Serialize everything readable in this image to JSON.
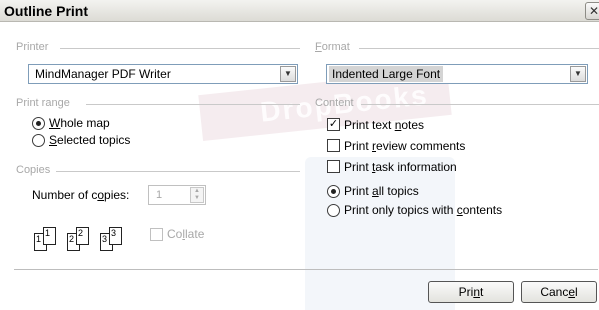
{
  "window": {
    "title": "Outline Print",
    "close_glyph": "✕"
  },
  "watermark": {
    "text": "DropBooks"
  },
  "printer": {
    "group_label": "Printer",
    "selected": "MindManager PDF Writer"
  },
  "format": {
    "group_label": "Format",
    "selected": "Indented Large Font"
  },
  "print_range": {
    "group_label": "Print range",
    "options": [
      {
        "label": "Whole map",
        "mnemonic": "W",
        "rest": "hole map",
        "checked": true
      },
      {
        "label": "Selected topics",
        "mnemonic": "S",
        "rest": "elected topics",
        "checked": false
      }
    ]
  },
  "content": {
    "group_label": "Content",
    "checkboxes": [
      {
        "before": "Print text ",
        "mnemonic": "n",
        "after": "otes",
        "checked": true
      },
      {
        "before": "Print ",
        "mnemonic": "r",
        "after": "eview comments",
        "checked": false
      },
      {
        "before": "Print ",
        "mnemonic": "t",
        "after": "ask information",
        "checked": false
      }
    ],
    "radios": [
      {
        "before": "Print ",
        "mnemonic": "a",
        "after": "ll topics",
        "checked": true
      },
      {
        "before": "Print only topics with ",
        "mnemonic": "c",
        "after": "ontents",
        "checked": false
      }
    ]
  },
  "copies": {
    "group_label": "Copies",
    "number_label_before": "Number of c",
    "number_label_mnemonic": "o",
    "number_label_after": "pies:",
    "value": "1",
    "collate_before": "Co",
    "collate_mnemonic": "l",
    "collate_after": "late",
    "collate_checked": false,
    "page_numbers": [
      "1",
      "1",
      "2",
      "2",
      "3",
      "3"
    ]
  },
  "buttons": {
    "print": {
      "before": "Pri",
      "mnemonic": "n",
      "after": "t"
    },
    "cancel": {
      "before": "Canc",
      "mnemonic": "e",
      "after": "l"
    }
  },
  "icons": {
    "dropdown": "chevron-down-icon",
    "close": "close-icon",
    "spin": "spin-arrows-icon"
  }
}
